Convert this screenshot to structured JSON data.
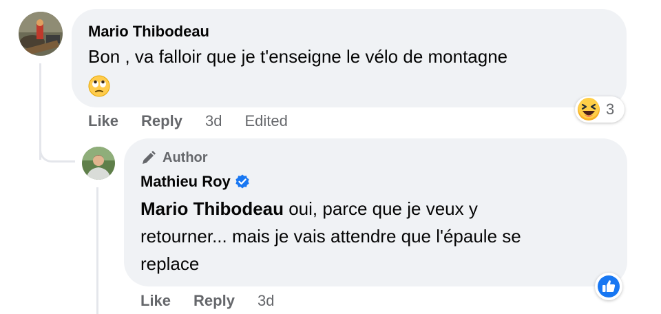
{
  "comment": {
    "author": "Mario Thibodeau",
    "text": "Bon , va falloir que je t'enseigne le vélo de montagne",
    "emoji": "🙄",
    "actions": {
      "like": "Like",
      "reply": "Reply",
      "time": "3d",
      "edited": "Edited"
    },
    "reaction": {
      "icon": "laughing-emoji",
      "count": "3"
    }
  },
  "reply": {
    "badge_icon": "pencil-icon",
    "badge": "Author",
    "author": "Mathieu Roy",
    "verified_icon": "verified-badge-icon",
    "mention": "Mario Thibodeau",
    "text_line1": " oui, parce que je veux y",
    "text_line2": "retourner... mais je vais attendre que l'épaule se",
    "text_line3": "replace",
    "actions": {
      "like": "Like",
      "reply": "Reply",
      "time": "3d"
    },
    "reaction": {
      "icon": "like-thumb-icon"
    }
  },
  "colors": {
    "bubble": "#f0f2f5",
    "secondary_text": "#65676b",
    "verified": "#1877f2",
    "like_blue": "#1877f2",
    "thread_line": "#e4e6eb"
  }
}
